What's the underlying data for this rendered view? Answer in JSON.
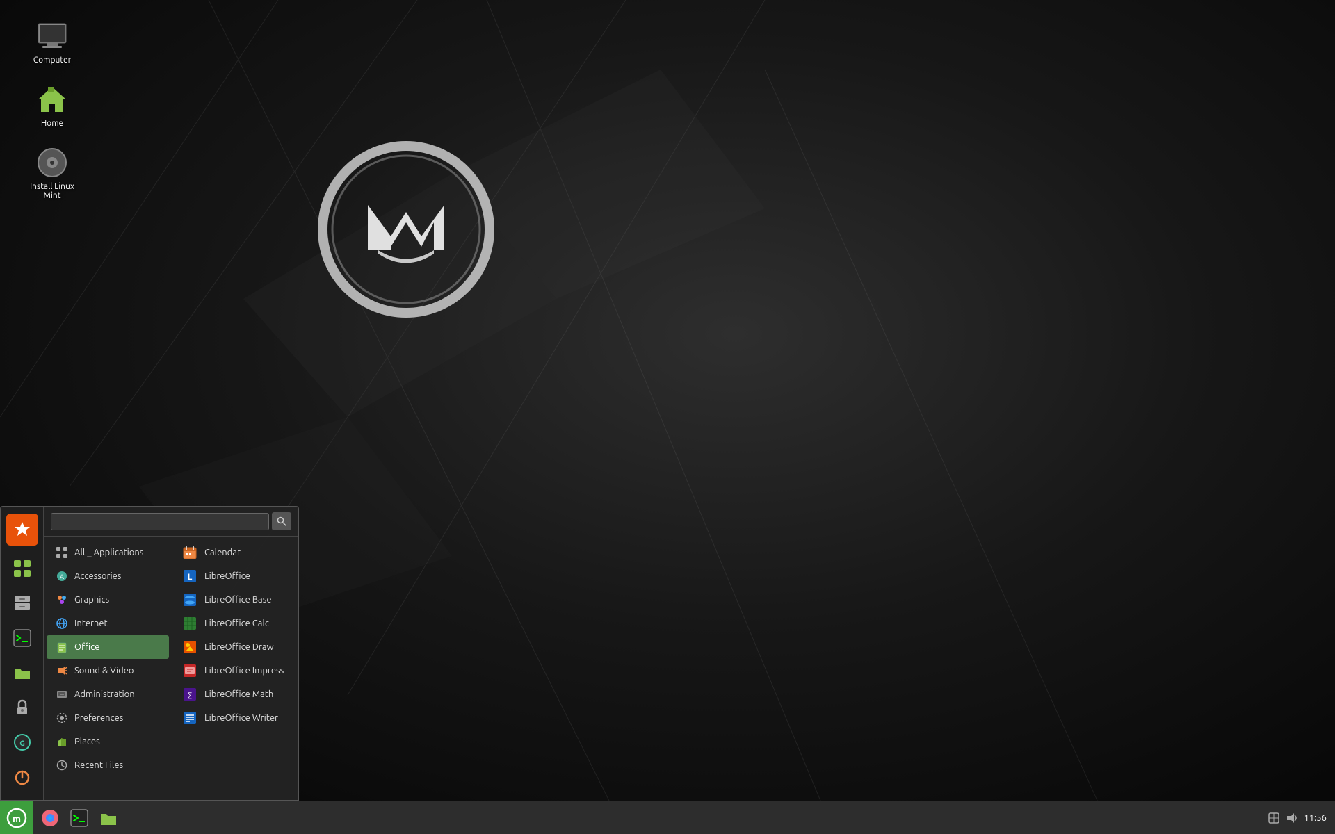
{
  "desktop": {
    "icons": [
      {
        "id": "computer",
        "label": "Computer",
        "iconType": "computer"
      },
      {
        "id": "home",
        "label": "Home",
        "iconType": "home"
      },
      {
        "id": "install",
        "label": "Install Linux Mint",
        "iconType": "disc"
      }
    ]
  },
  "taskbar": {
    "clock": "11:56",
    "items": [
      {
        "id": "mintmenu",
        "iconType": "mint"
      },
      {
        "id": "firefox",
        "iconType": "firefox"
      },
      {
        "id": "terminal",
        "iconType": "terminal"
      },
      {
        "id": "files",
        "iconType": "folder"
      }
    ]
  },
  "startmenu": {
    "search_placeholder": "",
    "search_icon": "search-icon",
    "sidebar_icons": [
      {
        "id": "favorites",
        "iconType": "star"
      },
      {
        "id": "apps",
        "iconType": "grid"
      },
      {
        "id": "files",
        "iconType": "cabinet"
      },
      {
        "id": "terminal",
        "iconType": "terminal"
      },
      {
        "id": "folder",
        "iconType": "folder"
      },
      {
        "id": "lock",
        "iconType": "lock"
      },
      {
        "id": "grub",
        "iconType": "grub"
      },
      {
        "id": "power",
        "iconType": "power"
      }
    ],
    "categories": [
      {
        "id": "all",
        "label": "All _ Applications",
        "iconType": "grid"
      },
      {
        "id": "accessories",
        "label": "Accessories",
        "iconType": "accessories"
      },
      {
        "id": "graphics",
        "label": "Graphics",
        "iconType": "graphics"
      },
      {
        "id": "internet",
        "label": "Internet",
        "iconType": "internet"
      },
      {
        "id": "office",
        "label": "Office",
        "iconType": "office",
        "active": true
      },
      {
        "id": "sound-video",
        "label": "Sound & Video",
        "iconType": "sound"
      },
      {
        "id": "administration",
        "label": "Administration",
        "iconType": "admin"
      },
      {
        "id": "preferences",
        "label": "Preferences",
        "iconType": "prefs"
      },
      {
        "id": "places",
        "label": "Places",
        "iconType": "places"
      },
      {
        "id": "recent",
        "label": "Recent Files",
        "iconType": "recent"
      }
    ],
    "apps": [
      {
        "id": "calendar",
        "label": "Calendar",
        "iconType": "calendar"
      },
      {
        "id": "libreoffice",
        "label": "LibreOffice",
        "iconType": "lo-main"
      },
      {
        "id": "lo-base",
        "label": "LibreOffice Base",
        "iconType": "lo-base"
      },
      {
        "id": "lo-calc",
        "label": "LibreOffice Calc",
        "iconType": "lo-calc"
      },
      {
        "id": "lo-draw",
        "label": "LibreOffice Draw",
        "iconType": "lo-draw"
      },
      {
        "id": "lo-impress",
        "label": "LibreOffice Impress",
        "iconType": "lo-impress"
      },
      {
        "id": "lo-math",
        "label": "LibreOffice Math",
        "iconType": "lo-math"
      },
      {
        "id": "lo-writer",
        "label": "LibreOffice Writer",
        "iconType": "lo-writer"
      }
    ]
  }
}
